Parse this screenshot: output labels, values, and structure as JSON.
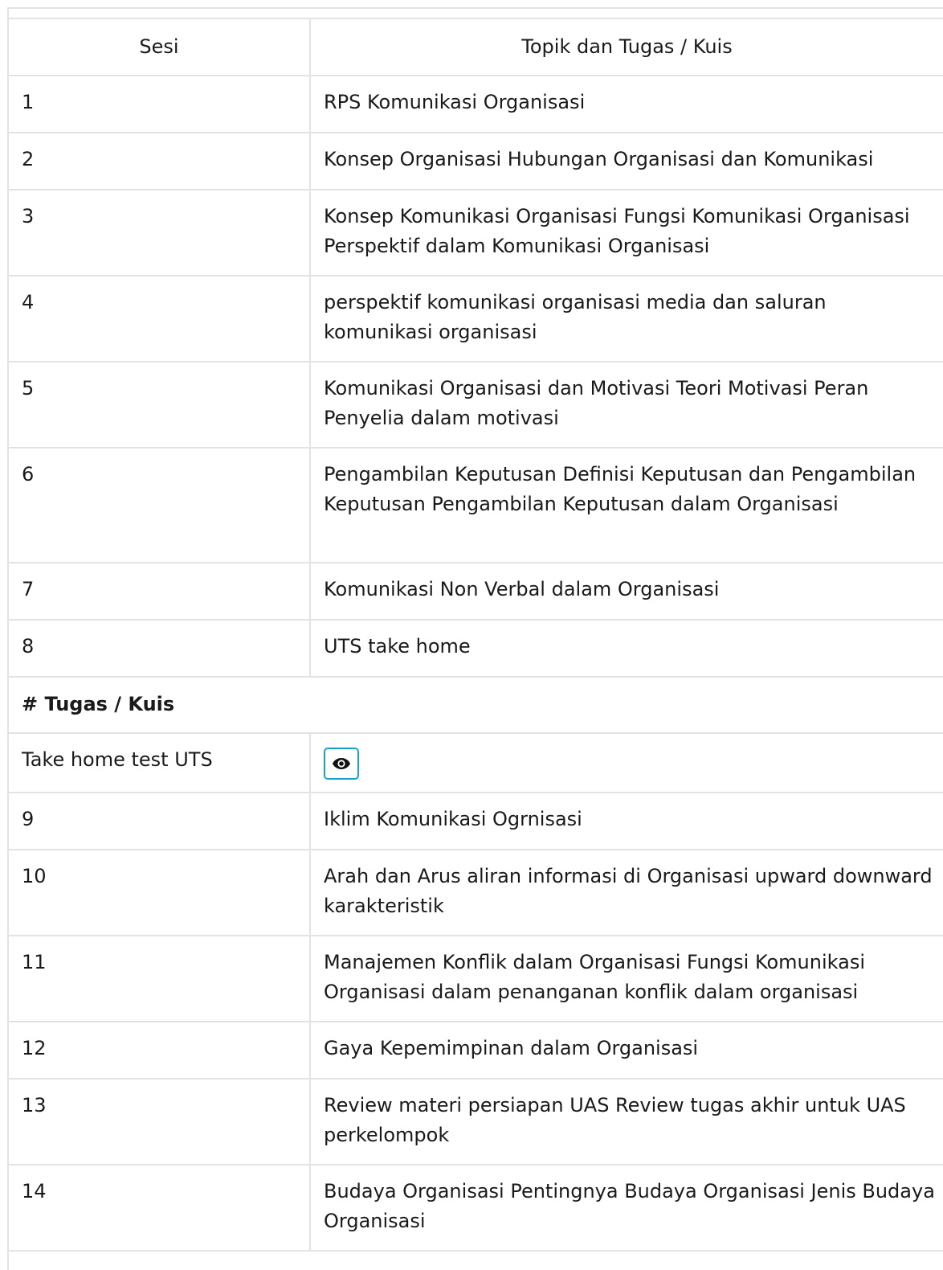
{
  "table": {
    "headers": {
      "sesi": "Sesi",
      "topik": "Topik dan Tugas / Kuis"
    },
    "rows_before_section": [
      {
        "sesi": "1",
        "topik": "RPS Komunikasi Organisasi"
      },
      {
        "sesi": "2",
        "topik": "Konsep Organisasi Hubungan Organisasi dan Komunikasi"
      },
      {
        "sesi": "3",
        "topik": "Konsep Komunikasi Organisasi Fungsi Komunikasi Organisasi Perspektif dalam Komunikasi Organisasi"
      },
      {
        "sesi": "4",
        "topik": "perspektif komunikasi organisasi media dan saluran komunikasi organisasi"
      },
      {
        "sesi": "5",
        "topik": "Komunikasi Organisasi dan Motivasi Teori Motivasi Peran Penyelia dalam motivasi"
      },
      {
        "sesi": "6",
        "topik": "Pengambilan Keputusan Definisi Keputusan dan Pengambilan Keputusan Pengambilan Keputusan dalam Organisasi"
      },
      {
        "sesi": "7",
        "topik": "Komunikasi Non Verbal dalam Organisasi"
      },
      {
        "sesi": "8",
        "topik": "UTS take home"
      }
    ],
    "section": {
      "title": "# Tugas / Kuis",
      "item_label": "Take home test UTS",
      "view_icon": "eye-icon",
      "accent_color": "#1aa3c8"
    },
    "rows_after_section": [
      {
        "sesi": "9",
        "topik": "Iklim Komunikasi Ogrnisasi"
      },
      {
        "sesi": "10",
        "topik": "Arah dan Arus aliran informasi di Organisasi upward downward karakteristik"
      },
      {
        "sesi": "11",
        "topik": "Manajemen Konflik dalam Organisasi Fungsi Komunikasi Organisasi dalam penanganan konflik dalam organisasi"
      },
      {
        "sesi": "12",
        "topik": "Gaya Kepemimpinan dalam Organisasi"
      },
      {
        "sesi": "13",
        "topik": "Review materi persiapan UAS Review tugas akhir untuk UAS perkelompok"
      },
      {
        "sesi": "14",
        "topik": "Budaya Organisasi Pentingnya Budaya Organisasi Jenis Budaya Organisasi"
      }
    ]
  }
}
